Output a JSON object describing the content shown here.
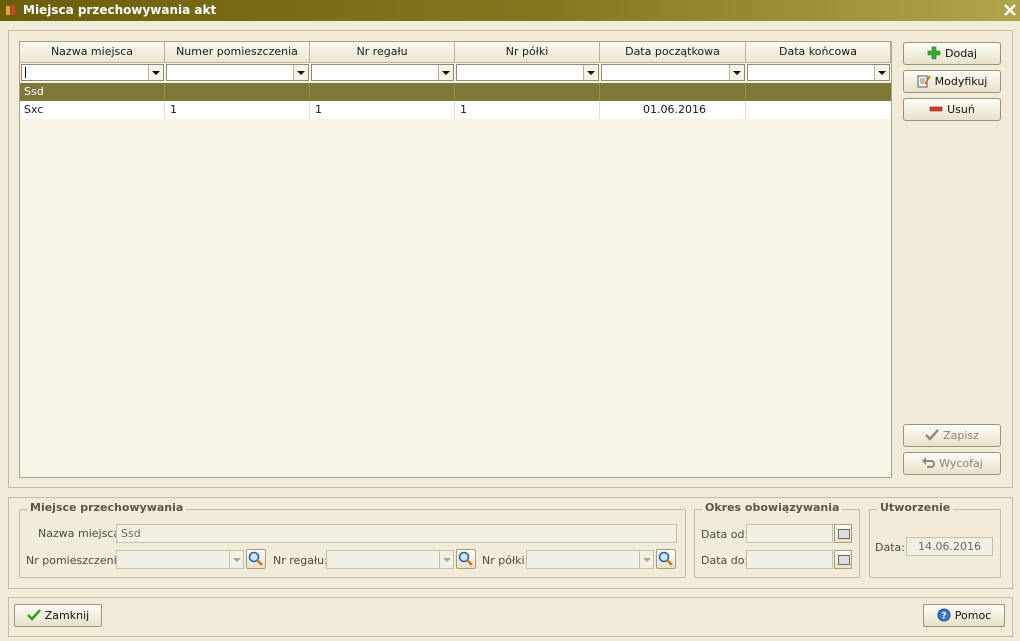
{
  "window": {
    "title": "Miejsca przechowywania akt"
  },
  "grid": {
    "columns": [
      "Nazwa miejsca",
      "Numer pomieszczenia",
      "Nr regału",
      "Nr półki",
      "Data początkowa",
      "Data końcowa"
    ],
    "group_row": {
      "name": "Ssd"
    },
    "rows": [
      {
        "name": "Sxc",
        "room": "1",
        "rack": "1",
        "shelf": "1",
        "start": "01.06.2016",
        "end": ""
      }
    ]
  },
  "actions": {
    "add": "Dodaj",
    "modify": "Modyfikuj",
    "delete": "Usuń",
    "save": "Zapisz",
    "revert": "Wycofaj"
  },
  "details": {
    "group_title": "Miejsce przechowywania",
    "name_label": "Nazwa miejsca:",
    "name_value": "Ssd",
    "room_label": "Nr pomieszczenia:",
    "rack_label": "Nr regału:",
    "shelf_label": "Nr półki:"
  },
  "validity": {
    "group_title": "Okres obowiązywania",
    "from_label": "Data od:",
    "to_label": "Data do:"
  },
  "creation": {
    "group_title": "Utworzenie",
    "date_label": "Data:",
    "date_value": "14.06.2016"
  },
  "footer": {
    "close": "Zamknij",
    "help": "Pomoc"
  },
  "colors": {
    "title_bar": "#7a6e18",
    "group_row": "#7f7737",
    "add_icon": "#3aa93a",
    "delete_icon": "#d93a2a"
  }
}
